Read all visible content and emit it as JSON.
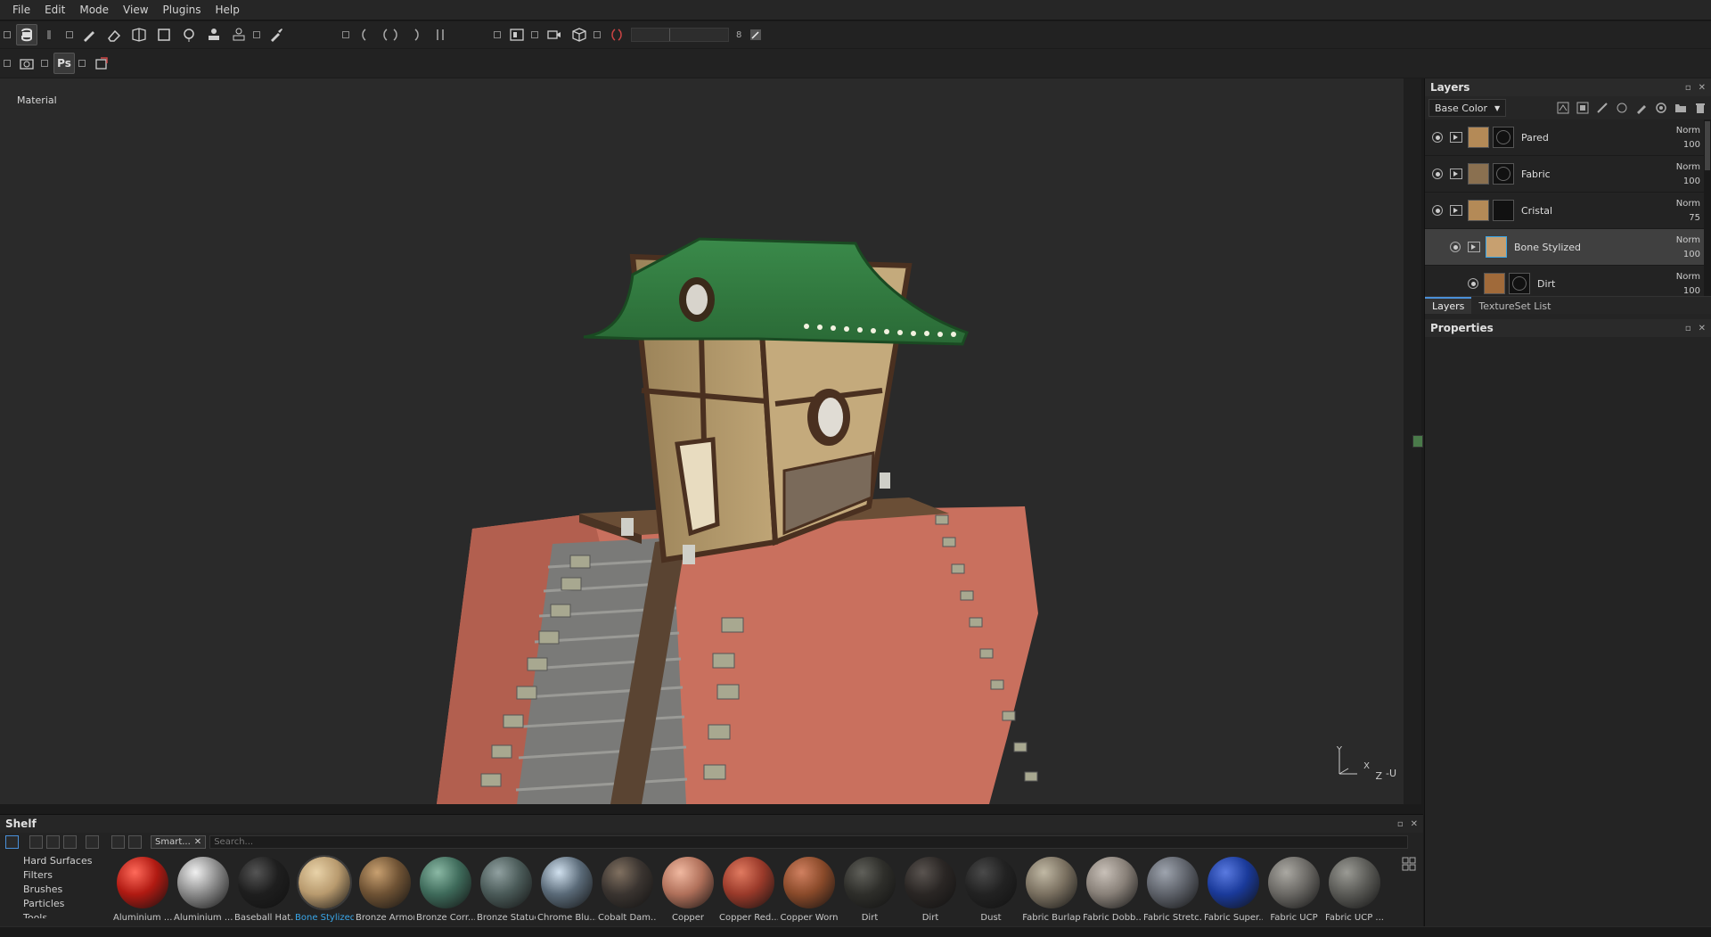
{
  "menu": [
    "File",
    "Edit",
    "Mode",
    "View",
    "Plugins",
    "Help"
  ],
  "viewport": {
    "label": "Material",
    "axis_x": "X",
    "axis_y": "Y",
    "axis_z": "Z",
    "axis_u": "-U"
  },
  "toolbar": {
    "slider_value": "8",
    "ps_label": "Ps"
  },
  "layers_panel": {
    "title": "Layers",
    "channel": "Base Color",
    "layers": [
      {
        "name": "Pared",
        "blend": "Norm",
        "opacity": "100",
        "thumb": "#b48a57"
      },
      {
        "name": "Fabric",
        "blend": "Norm",
        "opacity": "100",
        "thumb": "#8a7050"
      },
      {
        "name": "Cristal",
        "blend": "Norm",
        "opacity": "75",
        "thumb": "#b48a57"
      },
      {
        "name": "Bone Stylized",
        "blend": "Norm",
        "opacity": "100",
        "thumb": "#c7a070"
      },
      {
        "name": "Dirt",
        "blend": "Norm",
        "opacity": "100",
        "thumb": "#a06a3a"
      }
    ],
    "tabs": [
      "Layers",
      "TextureSet List"
    ]
  },
  "properties_panel": {
    "title": "Properties"
  },
  "shelf": {
    "title": "Shelf",
    "filter_tag": "Smart...",
    "search_placeholder": "Search...",
    "categories": [
      "Hard Surfaces",
      "Filters",
      "Brushes",
      "Particles",
      "Tools"
    ],
    "materials": [
      {
        "label": "Aluminium ...",
        "color": "#b01a12",
        "hi": "#ff6a5a"
      },
      {
        "label": "Aluminium ...",
        "color": "#8a8a8a",
        "hi": "#f0f0f0"
      },
      {
        "label": "Baseball Hat...",
        "color": "#1e1e1e",
        "hi": "#555555"
      },
      {
        "label": "Bone Stylized",
        "color": "#b89a6e",
        "hi": "#e8d2a8",
        "selected": true
      },
      {
        "label": "Bronze Armor",
        "color": "#6e5234",
        "hi": "#c8a070"
      },
      {
        "label": "Bronze Corr...",
        "color": "#3e6a5a",
        "hi": "#8ab8a4"
      },
      {
        "label": "Bronze Statue",
        "color": "#4a5a58",
        "hi": "#90a0a0"
      },
      {
        "label": "Chrome Blu...",
        "color": "#5a6a78",
        "hi": "#d0e0ee"
      },
      {
        "label": "Cobalt Dam...",
        "color": "#3a3430",
        "hi": "#807060"
      },
      {
        "label": "Copper",
        "color": "#b0705a",
        "hi": "#f0b8a0"
      },
      {
        "label": "Copper Red...",
        "color": "#9a3a2a",
        "hi": "#e07a60"
      },
      {
        "label": "Copper Worn",
        "color": "#8a4a2a",
        "hi": "#d08060"
      },
      {
        "label": "Dirt",
        "color": "#2e2e2a",
        "hi": "#60605a"
      },
      {
        "label": "Dirt",
        "color": "#2a2624",
        "hi": "#5a5450"
      },
      {
        "label": "Dust",
        "color": "#222222",
        "hi": "#4a4a4a"
      },
      {
        "label": "Fabric Burlap",
        "color": "#7a7060",
        "hi": "#c0b8a4"
      },
      {
        "label": "Fabric Dobb...",
        "color": "#888078",
        "hi": "#c8c0b8"
      },
      {
        "label": "Fabric Stretc...",
        "color": "#5e626a",
        "hi": "#9ea4ae"
      },
      {
        "label": "Fabric Super...",
        "color": "#1a3a9a",
        "hi": "#5a7ae0"
      },
      {
        "label": "Fabric UCP",
        "color": "#6a6864",
        "hi": "#aaa8a2"
      },
      {
        "label": "Fabric UCP ...",
        "color": "#5a5a56",
        "hi": "#9a9a94"
      }
    ]
  },
  "colors": {
    "accent": "#39a6e8",
    "viewport_bg": "#2a2a2a",
    "panel_bg": "#242424"
  }
}
